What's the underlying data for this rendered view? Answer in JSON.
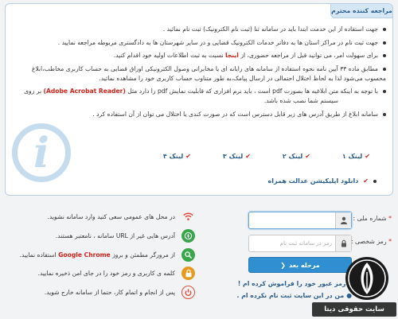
{
  "notice": {
    "tab_title": "مراجعه کننده محترم",
    "items": [
      "جهت استفاده از این خدمت ابتدا باید در سامانه ثنا (ثبت نام الکترونیک) ثبت نام نمائید .",
      "جهت ثبت نام در مراکز استان ها به دفاتر خدمات الکترونیک قضایی و در سایر شهرستان ها به دادگستری مربوطه مراجعه نمایید .",
      "محسوب می‌شود لذا به لحاظ اختلال احتمالی در ارسال پیامک،به طور متناوب حساب کاربری خود را مشاهده نمائید."
    ],
    "item3_before": "برای سهولت امر، می توانید قبل از مراجعه حضوری، از ",
    "item3_link": "اینجا",
    "item3_after": " نسبت به ثبت اطلاعات اولیه خود اقدام کنید.",
    "item4": "مطابق ماده ۳۳ آیین نامه نحوه استفاده از سامانه های رایانه ای یا مخابراتی وصول الکترونیکی اوراق قضایی به حساب کاربری مخاطب،ابلاغ",
    "item5_before": "با توجه به اینکه متن ابلاغیه ها بصورت pdf است ، باید نرم افزاری که قابلیت نمایش pdf را دارد مثل ",
    "item5_link": "(Adobe Acrobat Reader)",
    "item5_after": " بر روی",
    "item5_line2": "سیستم شما نصب شده باشد.",
    "item6": "سامانه ابلاغ از طریق آدرس های زیر قابل دسترس است که در صورت کندی یا اختلال می توان از آن استفاده کرد .",
    "links": [
      "لینک ۱",
      "لینک ۲",
      "لینک ۳",
      "لینک ۴"
    ],
    "app_download": "دانلود اپلیکیشن عدالت همراه"
  },
  "login": {
    "national_id_label": "شماره ملی :",
    "password_label": "رمز شخصی :",
    "password_placeholder": "رمز در سامانه ثبت نام",
    "submit_label": "مرحله بعد",
    "forgot_link": "رمز عبور خود را فراموش کرده ام !",
    "not_registered_link": "من در این سایت ثبت نام نکرده ام .",
    "required_star": "*"
  },
  "tips": [
    {
      "icon": "wifi-icon",
      "color": "#e24a3b",
      "text": "در محل های عمومی سعی کنید وارد سامانه نشوید."
    },
    {
      "icon": "compass-icon",
      "color": "#3aa64c",
      "text": "آدرس هایی غیر از URL سامانه ، نامعتبر هستند."
    },
    {
      "icon": "search-icon",
      "color": "#3aa64c",
      "text_before": "از مرورگر مطمئن و بروز ",
      "text_link": "Google Chrome",
      "text_after": " استفاده نمایید."
    },
    {
      "icon": "lock-icon",
      "color": "#e59a20",
      "text": "کلمه ی کاربری و رمز خود را در جای امن ذخیره نمایید."
    },
    {
      "icon": "power-icon",
      "color": "#e24a3b",
      "text": "پس از انجام و اتمام کار، حتما از سامانه خارج شوید."
    }
  ],
  "brand": {
    "text": "سایت حقوقی دیتا"
  },
  "colors": {
    "accent": "#2f8fd0",
    "link": "#2b5e8e",
    "alert": "#d3231b"
  }
}
